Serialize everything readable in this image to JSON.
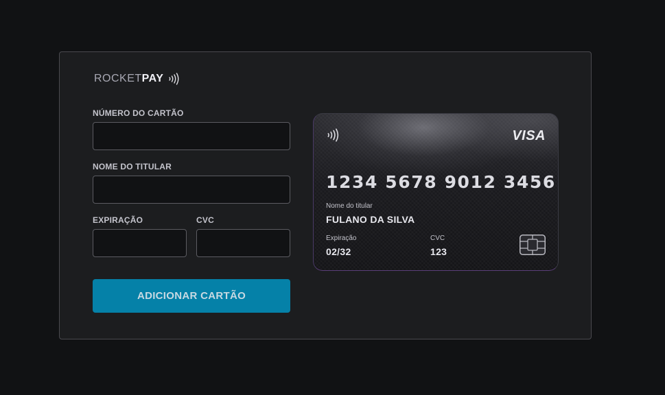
{
  "brand": {
    "light": "ROCKET",
    "bold": "PAY"
  },
  "form": {
    "card_number_label": "NÚMERO DO CARTÃO",
    "card_number_value": "",
    "holder_label": "NOME DO TITULAR",
    "holder_value": "",
    "expiration_label": "EXPIRAÇÃO",
    "expiration_value": "",
    "cvc_label": "CVC",
    "cvc_value": "",
    "submit_label": "ADICIONAR CARTÃO"
  },
  "card": {
    "brand": "VISA",
    "number": "1234 5678 9012 3456",
    "holder_caption": "Nome do titular",
    "holder": "FULANO DA SILVA",
    "expiration_caption": "Expiração",
    "expiration": "02/32",
    "cvc_caption": "CVC",
    "cvc": "123",
    "icons": [
      "contactless-icon",
      "chip-icon"
    ]
  },
  "colors": {
    "background": "#111214",
    "panel": "#1c1d1f",
    "button": "#0581a8",
    "input": "#111214"
  }
}
